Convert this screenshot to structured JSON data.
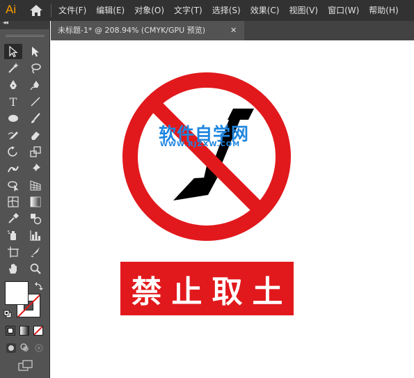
{
  "app": {
    "logo": "Ai",
    "menu": [
      "文件(F)",
      "编辑(E)",
      "对象(O)",
      "文字(T)",
      "选择(S)",
      "效果(C)",
      "视图(V)",
      "窗口(W)",
      "帮助(H)"
    ]
  },
  "toolpanel": {
    "collapse_label": "◂◂",
    "type_tool_glyph": "T"
  },
  "document": {
    "tab_title": "未标题-1* @ 208.94% (CMYK/GPU 预览)",
    "close_glyph": "✕"
  },
  "artwork": {
    "watermark_text": "软件自学网",
    "watermark_url": "WWW.RJZXW.COM",
    "sign_label": "禁止取土",
    "colors": {
      "sign_red": "#E1191C",
      "symbol_black": "#000000",
      "watermark_blue": "#1E86E0"
    }
  }
}
